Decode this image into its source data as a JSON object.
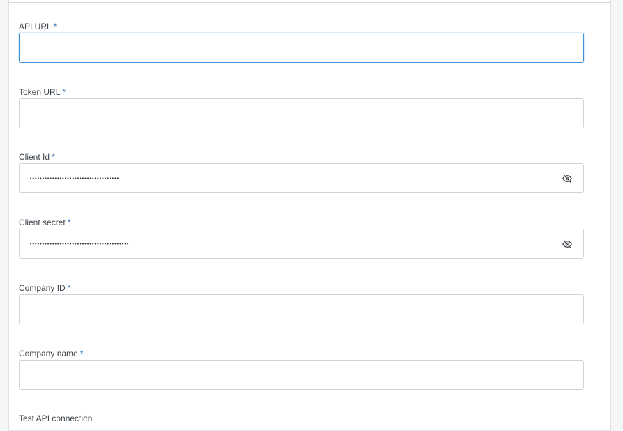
{
  "form": {
    "required_marker": "*",
    "fields": [
      {
        "label": "API URL",
        "value": "",
        "masked_value": "",
        "type": "text",
        "focused": true
      },
      {
        "label": "Token URL",
        "value": "",
        "masked_value": "",
        "type": "text",
        "focused": false
      },
      {
        "label": "Client Id",
        "value": "",
        "masked_value": "••••••••••••••••••••••••••••••••••••",
        "type": "password",
        "focused": false,
        "reveal_icon": "eye-slash-icon"
      },
      {
        "label": "Client secret",
        "value": "",
        "masked_value": "••••••••••••••••••••••••••••••••••••••••",
        "type": "password",
        "focused": false,
        "reveal_icon": "eye-slash-icon"
      },
      {
        "label": "Company ID",
        "value": "",
        "masked_value": "",
        "type": "text",
        "focused": false
      },
      {
        "label": "Company name",
        "value": "",
        "masked_value": "",
        "type": "text",
        "focused": false
      }
    ],
    "next_section": "Test API connection"
  },
  "colors": {
    "accent": "#3d8fd6",
    "required": "#2e74b8",
    "input_border": "#cfd3d8",
    "label": "#3e454c"
  }
}
